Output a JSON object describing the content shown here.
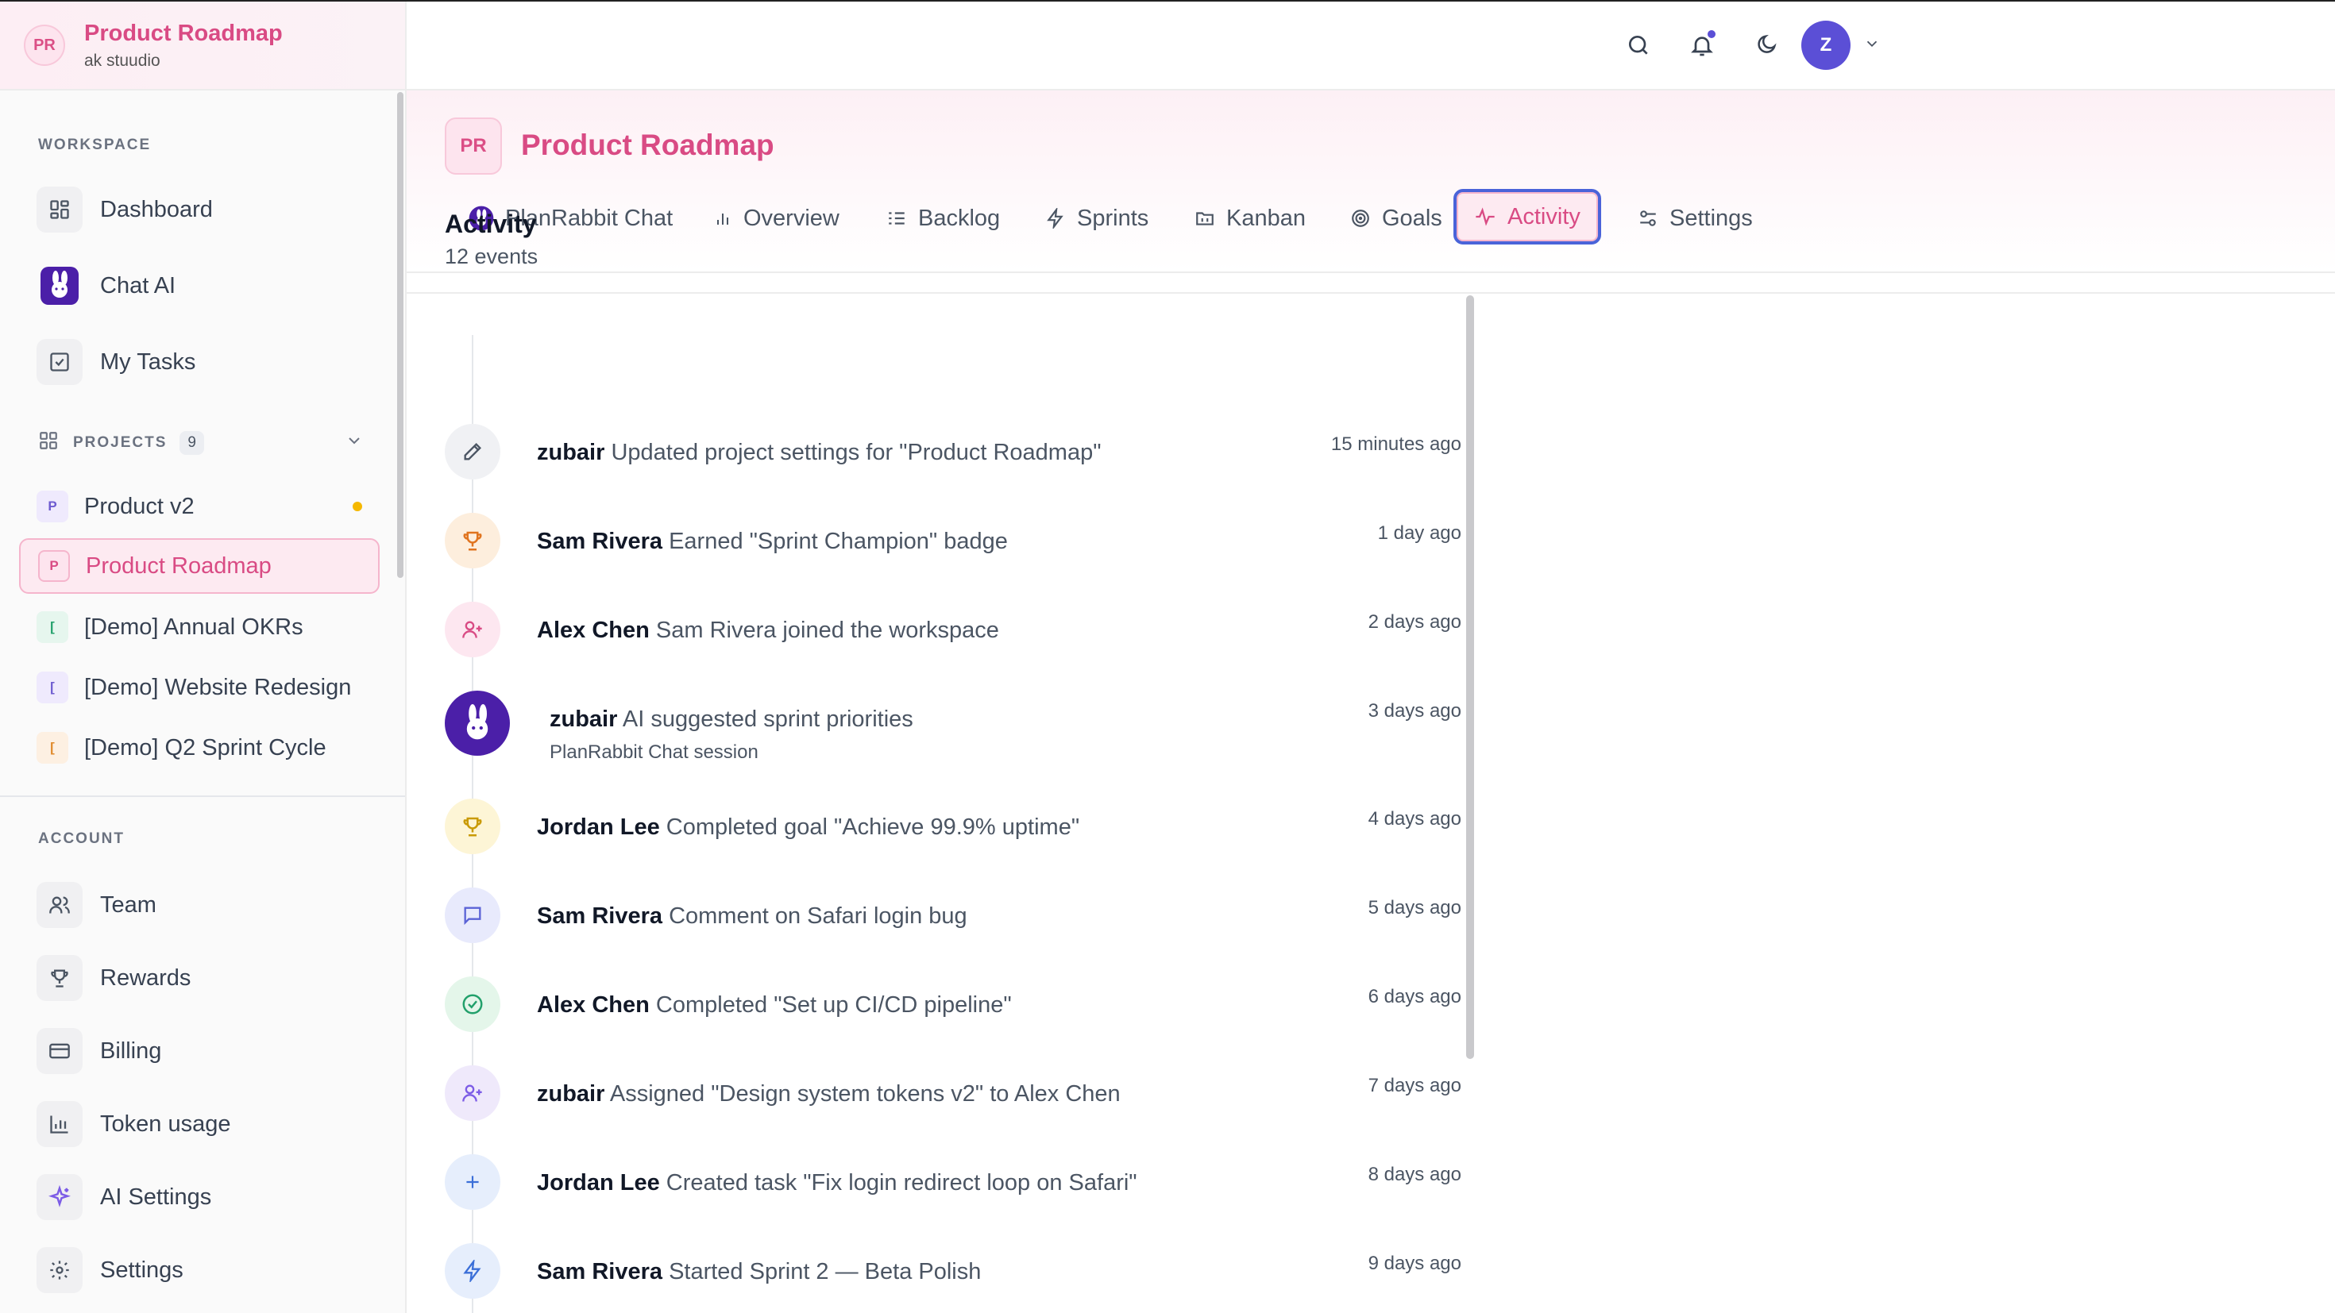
{
  "workspace": {
    "initials": "PR",
    "name": "Product Roadmap",
    "org": "ak stuudio"
  },
  "sidebar": {
    "workspace_label": "WORKSPACE",
    "workspace_items": [
      {
        "label": "Dashboard",
        "icon": "dashboard-icon"
      },
      {
        "label": "Chat AI",
        "icon": "rabbit-logo-icon"
      },
      {
        "label": "My Tasks",
        "icon": "checkbox-icon"
      }
    ],
    "projects_label": "PROJECTS",
    "projects_count": "9",
    "projects": [
      {
        "badge": "P",
        "label": "Product v2",
        "color": "#6d5bd0",
        "bg": "#efeafd",
        "dot": "#f5b800"
      },
      {
        "badge": "P",
        "label": "Product Roadmap",
        "color": "#d94b84",
        "bg": "#fde4ee",
        "active": true
      },
      {
        "badge": "[",
        "label": "[Demo] Annual OKRs",
        "color": "#22a06b",
        "bg": "#e6f6ee"
      },
      {
        "badge": "[",
        "label": "[Demo] Website Redesign",
        "color": "#6d5bd0",
        "bg": "#efeafd"
      },
      {
        "badge": "[",
        "label": "[Demo] Q2 Sprint Cycle",
        "color": "#e08a2b",
        "bg": "#fdf0e2"
      }
    ],
    "account_label": "ACCOUNT",
    "account_items": [
      {
        "label": "Team",
        "icon": "users-icon"
      },
      {
        "label": "Rewards",
        "icon": "trophy-icon"
      },
      {
        "label": "Billing",
        "icon": "credit-card-icon"
      },
      {
        "label": "Token usage",
        "icon": "bar-chart-icon"
      },
      {
        "label": "AI Settings",
        "icon": "sparkle-icon"
      },
      {
        "label": "Settings",
        "icon": "gear-icon"
      }
    ]
  },
  "topbar": {
    "avatar_initial": "Z",
    "accent": "#5b4fd6"
  },
  "project": {
    "initials": "PR",
    "title": "Product Roadmap"
  },
  "tabs": [
    {
      "label": "PlanRabbit Chat",
      "icon": "rabbit-logo-icon"
    },
    {
      "label": "Overview",
      "icon": "bar-chart-icon"
    },
    {
      "label": "Backlog",
      "icon": "list-icon"
    },
    {
      "label": "Sprints",
      "icon": "lightning-icon"
    },
    {
      "label": "Kanban",
      "icon": "folder-icon"
    },
    {
      "label": "Goals",
      "icon": "target-icon"
    },
    {
      "label": "Activity",
      "icon": "activity-icon",
      "active": true
    },
    {
      "label": "Settings",
      "icon": "sliders-icon"
    }
  ],
  "activity": {
    "title": "Activity",
    "count": "12 events",
    "events": [
      {
        "actor": "zubair",
        "text": "Updated project settings for \"Product Roadmap\"",
        "time": "15 minutes ago",
        "icon": "edit-icon"
      },
      {
        "actor": "Sam Rivera",
        "text": "Earned \"Sprint Champion\" badge",
        "time": "1 day ago",
        "icon": "trophy-icon"
      },
      {
        "actor": "Alex Chen",
        "text": "Sam Rivera joined the workspace",
        "time": "2 days ago",
        "icon": "user-plus-icon"
      },
      {
        "actor": "zubair",
        "text": "AI suggested sprint priorities",
        "time": "3 days ago",
        "icon": "rabbit-logo-icon",
        "sub": "PlanRabbit Chat session"
      },
      {
        "actor": "Jordan Lee",
        "text": "Completed goal \"Achieve 99.9% uptime\"",
        "time": "4 days ago",
        "icon": "trophy-icon"
      },
      {
        "actor": "Sam Rivera",
        "text": "Comment on Safari login bug",
        "time": "5 days ago",
        "icon": "comment-icon"
      },
      {
        "actor": "Alex Chen",
        "text": "Completed \"Set up CI/CD pipeline\"",
        "time": "6 days ago",
        "icon": "check-circle-icon"
      },
      {
        "actor": "zubair",
        "text": "Assigned \"Design system tokens v2\" to Alex Chen",
        "time": "7 days ago",
        "icon": "user-plus-icon"
      },
      {
        "actor": "Jordan Lee",
        "text": "Created task \"Fix login redirect loop on Safari\"",
        "time": "8 days ago",
        "icon": "plus-icon"
      },
      {
        "actor": "Sam Rivera",
        "text": "Started Sprint 2 — Beta Polish",
        "time": "9 days ago",
        "icon": "lightning-icon"
      }
    ]
  }
}
